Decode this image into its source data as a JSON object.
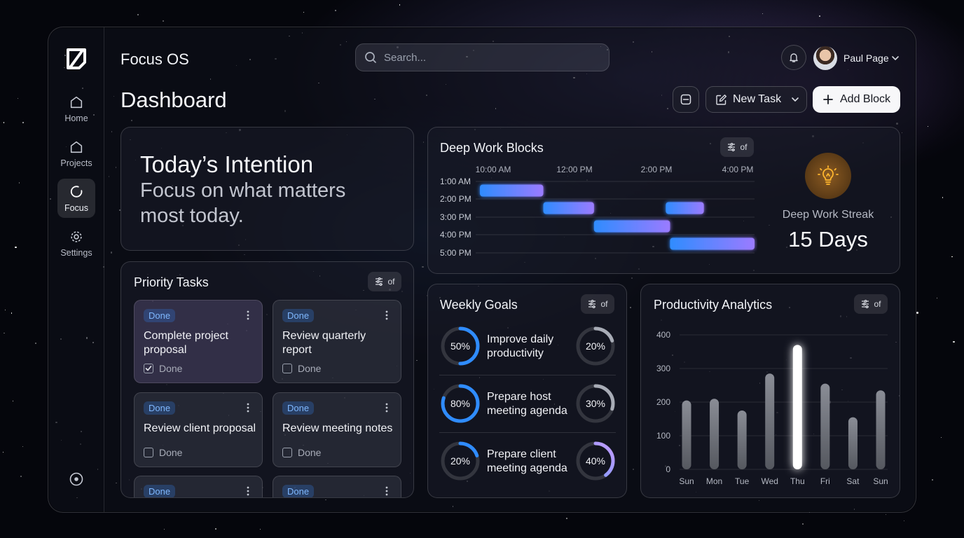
{
  "app": {
    "title": "Focus OS"
  },
  "sidebar": {
    "items": [
      {
        "label": "Home",
        "icon": "home-icon",
        "active": false
      },
      {
        "label": "Projects",
        "icon": "folder-icon",
        "active": false
      },
      {
        "label": "Focus",
        "icon": "focus-icon",
        "active": true
      },
      {
        "label": "Settings",
        "icon": "gear-icon",
        "active": false
      }
    ]
  },
  "search": {
    "placeholder": "Search..."
  },
  "user": {
    "name": "Paul Page"
  },
  "page": {
    "title": "Dashboard"
  },
  "toolbar": {
    "new_task_label": "New Task",
    "add_block_label": "Add Block"
  },
  "intention": {
    "title": "Today’s Intention",
    "text": "Focus on what matters most today."
  },
  "priority_tasks": {
    "title": "Priority Tasks",
    "pill_label": "of",
    "tasks": [
      {
        "status": "Done",
        "title": "Complete project proposal",
        "check_label": "Done",
        "checked": true
      },
      {
        "status": "Done",
        "title": "Review quarterly report",
        "check_label": "Done",
        "checked": false
      },
      {
        "status": "Done",
        "title": "Review client proposal",
        "check_label": "Done",
        "checked": false
      },
      {
        "status": "Done",
        "title": "Review meeting notes",
        "check_label": "Done",
        "checked": false
      },
      {
        "status": "Done"
      },
      {
        "status": "Done"
      }
    ]
  },
  "deep_work": {
    "title": "Deep Work Blocks",
    "pill_label": "of",
    "streak_label": "Deep Work Streak",
    "streak_value": "15 Days"
  },
  "weekly_goals": {
    "title": "Weekly Goals",
    "pill_label": "of",
    "goals": [
      {
        "label": "Improve daily productivity",
        "progress_label": "50%",
        "progress": 50,
        "secondary_label": "20%",
        "secondary": 20
      },
      {
        "label": "Prepare host meeting agenda",
        "progress_label": "80%",
        "progress": 80,
        "secondary_label": "30%",
        "secondary": 30
      },
      {
        "label": "Prepare client meeting agenda",
        "progress_label": "20%",
        "progress": 20,
        "secondary_label": "40%",
        "secondary": 40
      }
    ]
  },
  "analytics": {
    "title": "Productivity Analytics",
    "pill_label": "of"
  },
  "colors": {
    "accent": "#2f8cff",
    "accent2": "#9b7bff",
    "badge": "#7fb8ff",
    "streak": "#f5a623"
  },
  "chart_data": [
    {
      "type": "gantt",
      "x_ticks": [
        "10:00 AM",
        "12:00 PM",
        "2:00 PM",
        "4:00 PM"
      ],
      "rows": [
        "1:00 AM",
        "2:00 PM",
        "3:00 PM",
        "4:00 PM",
        "5:00 PM"
      ],
      "blocks": [
        {
          "row": 0,
          "start": 10.0,
          "end": 11.5
        },
        {
          "row": 1,
          "start": 11.5,
          "end": 12.7
        },
        {
          "row": 1,
          "start": 14.4,
          "end": 15.3
        },
        {
          "row": 2,
          "start": 12.7,
          "end": 14.5
        },
        {
          "row": 3,
          "start": 14.5,
          "end": 16.5
        }
      ],
      "x_range": [
        9.9,
        16.5
      ]
    },
    {
      "type": "bar",
      "categories": [
        "Sun",
        "Mon",
        "Tue",
        "Wed",
        "Thu",
        "Fri",
        "Sat",
        "Sun"
      ],
      "values": [
        205,
        210,
        175,
        285,
        370,
        255,
        155,
        235
      ],
      "highlight_index": 4,
      "yticks": [
        0,
        100,
        200,
        300,
        400
      ],
      "ylim": [
        0,
        400
      ]
    }
  ]
}
